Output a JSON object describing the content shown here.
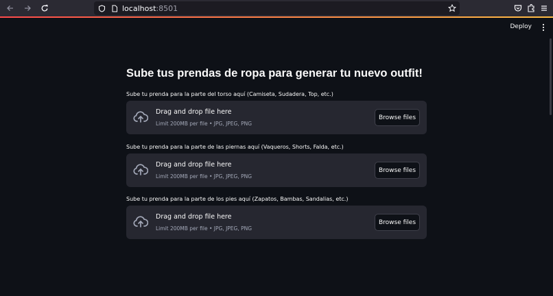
{
  "browser": {
    "url_host": "localhost",
    "url_port": ":8501"
  },
  "header": {
    "deploy_label": "Deploy"
  },
  "main": {
    "title": "Sube tus prendas de ropa para generar tu nuevo outfit!",
    "uploaders": [
      {
        "label": "Sube tu prenda para la parte del torso aquí (Camiseta, Sudadera, Top, etc.)",
        "drop_text": "Drag and drop file here",
        "limit_text": "Limit 200MB per file • JPG, JPEG, PNG",
        "button_label": "Browse files"
      },
      {
        "label": "Sube tu prenda para la parte de las piernas aquí (Vaqueros, Shorts, Falda, etc.)",
        "drop_text": "Drag and drop file here",
        "limit_text": "Limit 200MB per file • JPG, JPEG, PNG",
        "button_label": "Browse files"
      },
      {
        "label": "Sube tu prenda para la parte de los pies aquí (Zapatos, Bambas, Sandalias, etc.)",
        "drop_text": "Drag and drop file here",
        "limit_text": "Limit 200MB per file • JPG, JPEG, PNG",
        "button_label": "Browse files"
      }
    ]
  },
  "colors": {
    "background": "#0e1117",
    "dropzone": "#262730",
    "accent_start": "#ff4b4b",
    "accent_end": "#ffbd45"
  }
}
